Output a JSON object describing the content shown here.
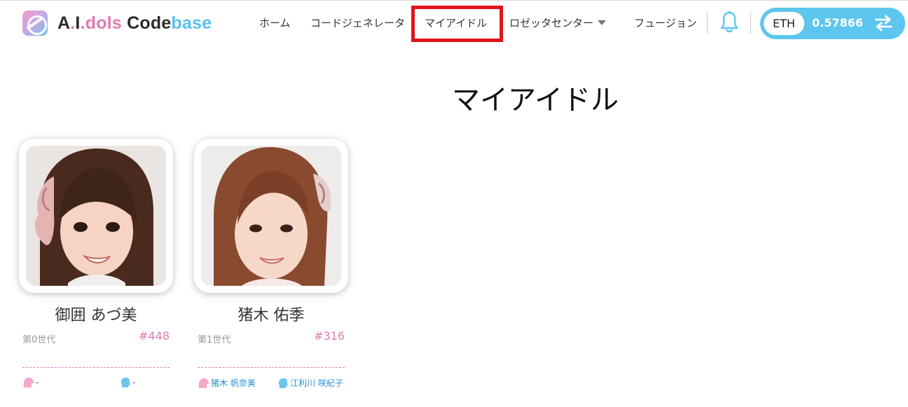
{
  "brand": {
    "part_a": "A",
    "dot1": ".",
    "part_i": "I",
    "dot2": ".",
    "part_dols": "dols",
    "part_code": "Code",
    "part_base": "base"
  },
  "nav": {
    "items": [
      {
        "label": "ホーム"
      },
      {
        "label": "コードジェネレータ"
      },
      {
        "label": "マイアイドル",
        "active": true
      },
      {
        "label": "ロゼッタセンター",
        "has_dropdown": true
      },
      {
        "label": "フュージョン"
      }
    ]
  },
  "wallet": {
    "currency": "ETH",
    "amount": "0.57866"
  },
  "page": {
    "title": "マイアイドル"
  },
  "idols": [
    {
      "name": "御囲 あづ美",
      "generation": "第0世代",
      "id": "#448",
      "mother": "-",
      "father": "-"
    },
    {
      "name": "猪木 佑季",
      "generation": "第1世代",
      "id": "#316",
      "mother": "猪木 帆奈美",
      "father": "江利川 咲紀子"
    }
  ],
  "colors": {
    "accent_pink": "#e07bb3",
    "accent_blue": "#5cc6ee",
    "highlight_red": "#e0141e",
    "link_blue": "#1f8fd1"
  },
  "icons": {
    "bell": "bell-icon",
    "swap": "swap-arrows-icon",
    "mother": "female-head-icon",
    "father": "male-head-icon"
  }
}
